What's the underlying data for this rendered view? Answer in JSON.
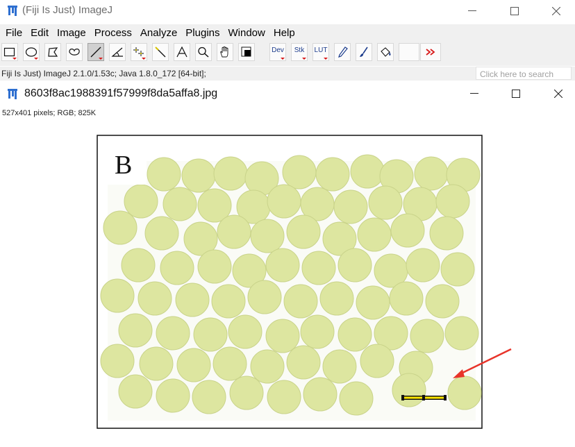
{
  "app": {
    "title": "(Fiji Is Just) ImageJ",
    "logo_icon": "fiji-logo-icon"
  },
  "window_controls": [
    "minimize-icon",
    "maximize-icon",
    "close-icon"
  ],
  "menu": [
    "File",
    "Edit",
    "Image",
    "Process",
    "Analyze",
    "Plugins",
    "Window",
    "Help"
  ],
  "toolbar": {
    "tools": [
      {
        "name": "rectangle-tool",
        "icon": "rectangle-icon",
        "selected": false
      },
      {
        "name": "oval-tool",
        "icon": "oval-icon",
        "selected": false
      },
      {
        "name": "polygon-tool",
        "icon": "polygon-icon",
        "selected": false
      },
      {
        "name": "freehand-tool",
        "icon": "freehand-icon",
        "selected": false
      },
      {
        "name": "line-tool",
        "icon": "line-icon",
        "selected": true
      },
      {
        "name": "angle-tool",
        "icon": "angle-icon",
        "selected": false
      },
      {
        "name": "point-tool",
        "icon": "multipoint-icon",
        "selected": false
      },
      {
        "name": "wand-tool",
        "icon": "wand-icon",
        "selected": false
      },
      {
        "name": "text-tool",
        "icon": "text-icon",
        "selected": false
      },
      {
        "name": "magnifier-tool",
        "icon": "magnifier-icon",
        "selected": false
      },
      {
        "name": "scroll-tool",
        "icon": "hand-icon",
        "selected": false
      },
      {
        "name": "color-picker-tool",
        "icon": "color-picker-icon",
        "selected": false
      },
      {
        "name": "dev-menu",
        "label": "Dev",
        "selected": false
      },
      {
        "name": "stk-menu",
        "label": "Stk",
        "selected": false
      },
      {
        "name": "lut-menu",
        "label": "LUT",
        "selected": false
      },
      {
        "name": "pencil-tool",
        "icon": "pencil-icon",
        "selected": false
      },
      {
        "name": "brush-tool",
        "icon": "brush-icon",
        "selected": false
      },
      {
        "name": "flood-fill-tool",
        "icon": "bucket-icon",
        "selected": false
      },
      {
        "name": "empty-slot",
        "icon": "",
        "selected": false
      },
      {
        "name": "more-tools",
        "icon": "double-chevron-right-icon",
        "selected": false
      }
    ]
  },
  "status": {
    "text": "Fiji Is Just) ImageJ 2.1.0/1.53c; Java 1.8.0_172 [64-bit];",
    "search_placeholder": "Click here to search"
  },
  "image_window": {
    "title": "8603f8ac1988391f57999f8da5affa8.jpg",
    "info": "527x401 pixels; RGB; 825K",
    "figure_label": "B",
    "colors": {
      "cell_fill": "#dde6a0",
      "cell_edge": "#c9d38a",
      "background": "#fafbf6",
      "annotation_arrow": "#e8342a",
      "scale_bar": "#ffe600"
    }
  }
}
